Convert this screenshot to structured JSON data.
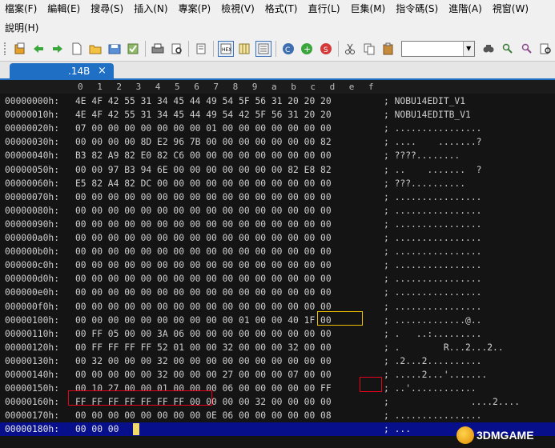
{
  "menu": {
    "row1": [
      "檔案(F)",
      "編輯(E)",
      "搜尋(S)",
      "插入(N)",
      "專案(P)",
      "檢視(V)",
      "格式(T)",
      "直行(L)",
      "巨集(M)",
      "指令碼(S)",
      "進階(A)",
      "視窗(W)"
    ],
    "row2": [
      "說明(H)"
    ]
  },
  "toolbar": {
    "icons": [
      "open-file-icon",
      "back-icon",
      "forward-icon",
      "new-file-icon",
      "open-folder-icon",
      "save-icon",
      "save-all-icon",
      "print-icon",
      "print-preview-icon",
      "document-properties-icon",
      "hex-mode-icon",
      "column-mode-icon",
      "line-numbers-icon",
      "cut-icon",
      "copy-icon",
      "paste-icon",
      "web-icon",
      "add-icon",
      "spell-icon",
      "find-icon",
      "find-next-icon",
      "replace-icon",
      "find-in-files-icon"
    ],
    "combo_value": ""
  },
  "tab": {
    "label": ".14B",
    "close": "×"
  },
  "columns": [
    "0",
    "1",
    "2",
    "3",
    "4",
    "5",
    "6",
    "7",
    "8",
    "9",
    "a",
    "b",
    "c",
    "d",
    "e",
    "f"
  ],
  "rows": [
    {
      "addr": "00000000h:",
      "bytes": "4E 4F 42 55 31 34 45 44 49 54 5F 56 31 20 20 20",
      "ascii": "; NOBU14EDIT_V1"
    },
    {
      "addr": "00000010h:",
      "bytes": "4E 4F 42 55 31 34 45 44 49 54 42 5F 56 31 20 20",
      "ascii": "; NOBU14EDITB_V1"
    },
    {
      "addr": "00000020h:",
      "bytes": "07 00 00 00 00 00 00 00 01 00 00 00 00 00 00 00",
      "ascii": "; ................"
    },
    {
      "addr": "00000030h:",
      "bytes": "00 00 00 00 8D E2 96 7B 00 00 00 00 00 00 00 82",
      "ascii": "; ....    .......?"
    },
    {
      "addr": "00000040h:",
      "bytes": "B3 82 A9 82 E0 82 C6 00 00 00 00 00 00 00 00 00",
      "ascii": "; ????........"
    },
    {
      "addr": "00000050h:",
      "bytes": "00 00 97 B3 94 6E 00 00 00 00 00 00 00 82 E8 82",
      "ascii": "; ..    .......  ?"
    },
    {
      "addr": "00000060h:",
      "bytes": "E5 82 A4 82 DC 00 00 00 00 00 00 00 00 00 00 00",
      "ascii": "; ???.........."
    },
    {
      "addr": "00000070h:",
      "bytes": "00 00 00 00 00 00 00 00 00 00 00 00 00 00 00 00",
      "ascii": "; ................"
    },
    {
      "addr": "00000080h:",
      "bytes": "00 00 00 00 00 00 00 00 00 00 00 00 00 00 00 00",
      "ascii": "; ................"
    },
    {
      "addr": "00000090h:",
      "bytes": "00 00 00 00 00 00 00 00 00 00 00 00 00 00 00 00",
      "ascii": "; ................"
    },
    {
      "addr": "000000a0h:",
      "bytes": "00 00 00 00 00 00 00 00 00 00 00 00 00 00 00 00",
      "ascii": "; ................"
    },
    {
      "addr": "000000b0h:",
      "bytes": "00 00 00 00 00 00 00 00 00 00 00 00 00 00 00 00",
      "ascii": "; ................"
    },
    {
      "addr": "000000c0h:",
      "bytes": "00 00 00 00 00 00 00 00 00 00 00 00 00 00 00 00",
      "ascii": "; ................"
    },
    {
      "addr": "000000d0h:",
      "bytes": "00 00 00 00 00 00 00 00 00 00 00 00 00 00 00 00",
      "ascii": "; ................"
    },
    {
      "addr": "000000e0h:",
      "bytes": "00 00 00 00 00 00 00 00 00 00 00 00 00 00 00 00",
      "ascii": "; ................"
    },
    {
      "addr": "000000f0h:",
      "bytes": "00 00 00 00 00 00 00 00 00 00 00 00 00 00 00 00",
      "ascii": "; ................"
    },
    {
      "addr": "00000100h:",
      "bytes": "00 00 00 00 00 00 00 00 00 00 01 00 00 40 1F 00",
      "ascii": "; .............@.."
    },
    {
      "addr": "00000110h:",
      "bytes": "00 FF 05 00 00 3A 06 00 00 00 00 00 00 00 00 00",
      "ascii": "; .   ..:........."
    },
    {
      "addr": "00000120h:",
      "bytes": "00 FF FF FF FF 52 01 00 00 32 00 00 00 32 00 00",
      "ascii": "; .        R...2...2.."
    },
    {
      "addr": "00000130h:",
      "bytes": "00 32 00 00 00 32 00 00 00 00 00 00 00 00 00 00",
      "ascii": "; .2...2.........."
    },
    {
      "addr": "00000140h:",
      "bytes": "00 00 00 00 00 32 00 00 00 27 00 00 00 07 00 00",
      "ascii": "; .....2...'......."
    },
    {
      "addr": "00000150h:",
      "bytes": "00 10 27 00 00 01 00 00 00 06 00 00 00 00 00 FF",
      "ascii": "; ..'............"
    },
    {
      "addr": "00000160h:",
      "bytes": "FF FF FF FF FF FF FF 00 00 00 00 32 00 00 00 00",
      "ascii": ";               ....2...."
    },
    {
      "addr": "00000170h:",
      "bytes": "00 00 00 00 00 00 00 00 0E 06 00 00 00 00 00 08",
      "ascii": "; ................"
    },
    {
      "addr": "00000180h:",
      "bytes": "00 00 00",
      "ascii": "; ..."
    }
  ],
  "watermark": {
    "text": "3DMGAME"
  }
}
